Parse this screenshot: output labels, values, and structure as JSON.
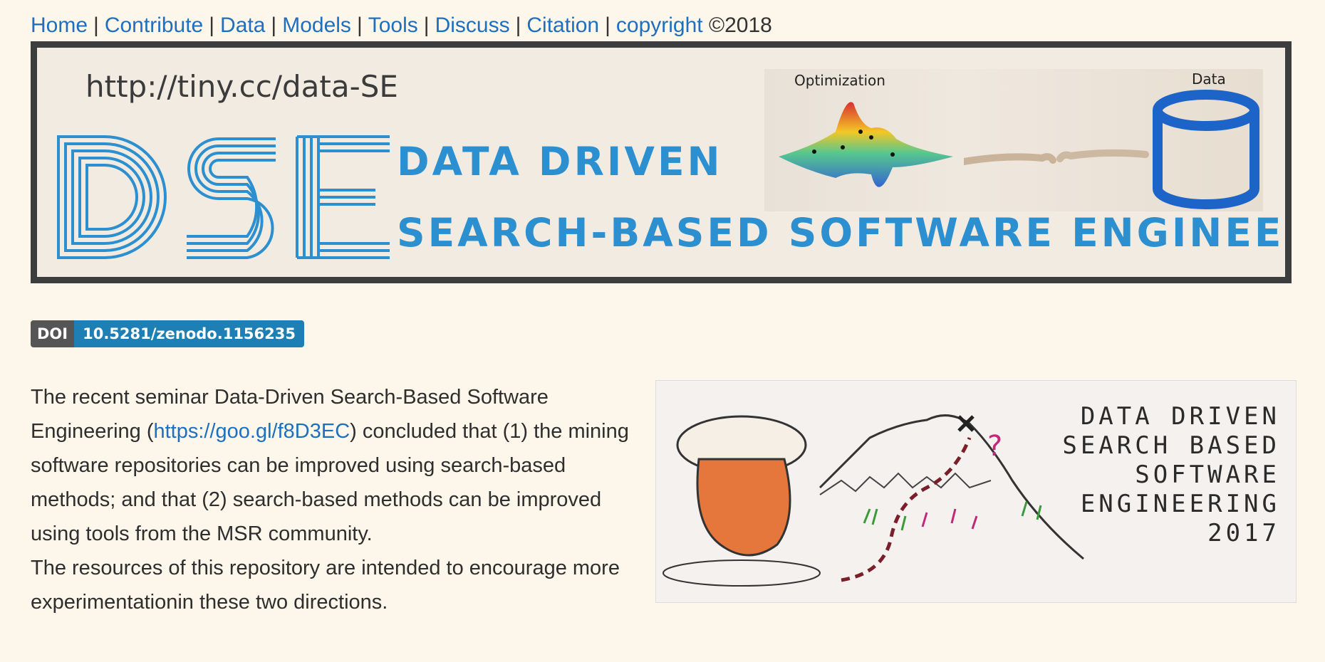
{
  "nav": {
    "items": [
      "Home",
      "Contribute",
      "Data",
      "Models",
      "Tools",
      "Discuss",
      "Citation",
      "copyright"
    ],
    "copyright_suffix": "©2018"
  },
  "banner": {
    "url": "http://tiny.cc/data-SE",
    "acronym": "DSE",
    "line1": "DATA DRIVEN",
    "line2": "SEARCH-BASED SOFTWARE ENGINEERING",
    "label_optimization": "Optimization",
    "label_data": "Data"
  },
  "doi": {
    "label": "DOI",
    "value": "10.5281/zenodo.1156235"
  },
  "content": {
    "p1_before": "The recent seminar Data-Driven Search-Based Software Engineering (",
    "p1_link": "https://goo.gl/f8D3EC",
    "p1_after": ") concluded that (1) the mining software repositories can be improved using search-based methods; and that (2) search-based methods can be improved using tools from the MSR community.",
    "p2": "The resources of this repository are intended to encourage more experimentationin these two directions."
  },
  "whiteboard": {
    "title_lines": [
      "DATA DRIVEN",
      "SEARCH BASED",
      "SOFTWARE",
      "ENGINEERING",
      "2017"
    ]
  }
}
